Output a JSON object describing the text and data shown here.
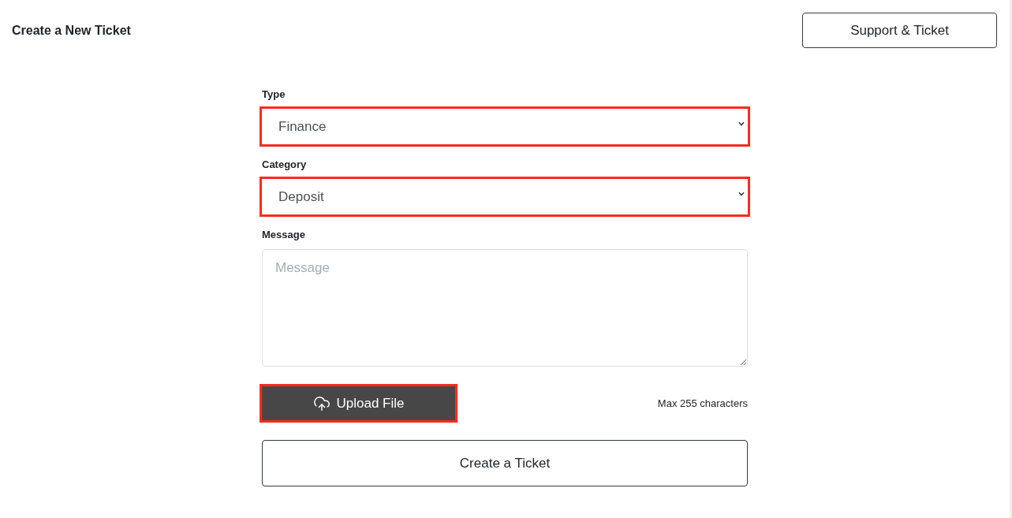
{
  "header": {
    "title": "Create a New Ticket",
    "button": "Support & Ticket"
  },
  "form": {
    "fields": [
      {
        "kind": "select",
        "label": "Type",
        "value": "Finance",
        "highlighted": true
      },
      {
        "kind": "select",
        "label": "Category",
        "value": "Deposit",
        "highlighted": true
      },
      {
        "kind": "textarea",
        "label": "Message",
        "placeholder": "Message",
        "highlighted": false
      }
    ],
    "upload_button": {
      "label": "Upload File",
      "highlighted": true
    },
    "char_limit": "Max 255 characters",
    "submit_button": {
      "label": "Create a Ticket"
    }
  }
}
